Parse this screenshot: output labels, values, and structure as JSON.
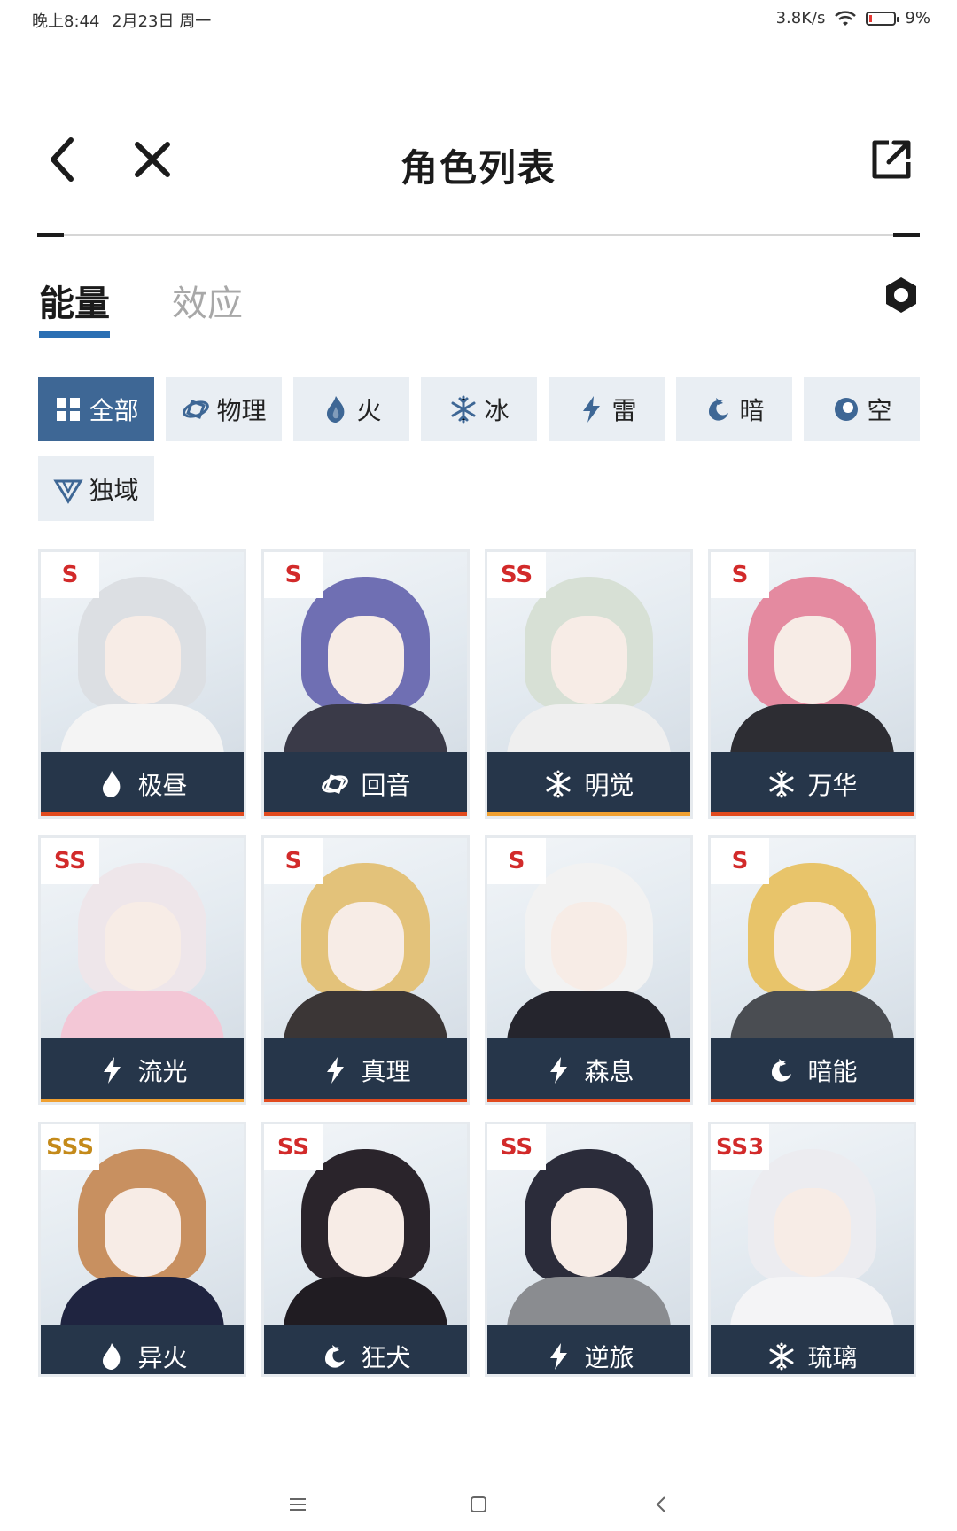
{
  "status_bar": {
    "time": "晚上8:44",
    "date": "2月23日 周一",
    "network_speed": "3.8K/s",
    "battery": "9%"
  },
  "header": {
    "title": "角色列表"
  },
  "tabs": [
    {
      "label": "能量",
      "active": true
    },
    {
      "label": "效应",
      "active": false
    }
  ],
  "filters": [
    {
      "label": "全部",
      "icon": "grid-icon",
      "active": true
    },
    {
      "label": "物理",
      "icon": "physical-icon",
      "active": false
    },
    {
      "label": "火",
      "icon": "fire-icon",
      "active": false
    },
    {
      "label": "冰",
      "icon": "ice-icon",
      "active": false
    },
    {
      "label": "雷",
      "icon": "lightning-icon",
      "active": false
    },
    {
      "label": "暗",
      "icon": "dark-icon",
      "active": false
    },
    {
      "label": "空",
      "icon": "void-icon",
      "active": false
    },
    {
      "label": "独域",
      "icon": "domain-icon",
      "active": false
    }
  ],
  "characters": [
    {
      "name": "极昼",
      "rank": "S",
      "element": "fire-icon"
    },
    {
      "name": "回音",
      "rank": "S",
      "element": "physical-icon"
    },
    {
      "name": "明觉",
      "rank": "SS",
      "element": "ice-icon"
    },
    {
      "name": "万华",
      "rank": "S",
      "element": "ice-icon"
    },
    {
      "name": "流光",
      "rank": "SS",
      "element": "lightning-icon"
    },
    {
      "name": "真理",
      "rank": "S",
      "element": "lightning-icon"
    },
    {
      "name": "森息",
      "rank": "S",
      "element": "lightning-icon"
    },
    {
      "name": "暗能",
      "rank": "S",
      "element": "dark-icon"
    },
    {
      "name": "异火",
      "rank": "SSS",
      "element": "fire-icon"
    },
    {
      "name": "狂犬",
      "rank": "SS",
      "element": "dark-icon"
    },
    {
      "name": "逆旅",
      "rank": "SS",
      "element": "lightning-icon"
    },
    {
      "name": "琉璃",
      "rank": "SS3",
      "element": "ice-icon"
    }
  ],
  "colors": {
    "accent_blue": "#3e6795",
    "namebar": "#26364a",
    "rank_red": "#d22a2a",
    "rank_gold": "#c48a1a"
  }
}
